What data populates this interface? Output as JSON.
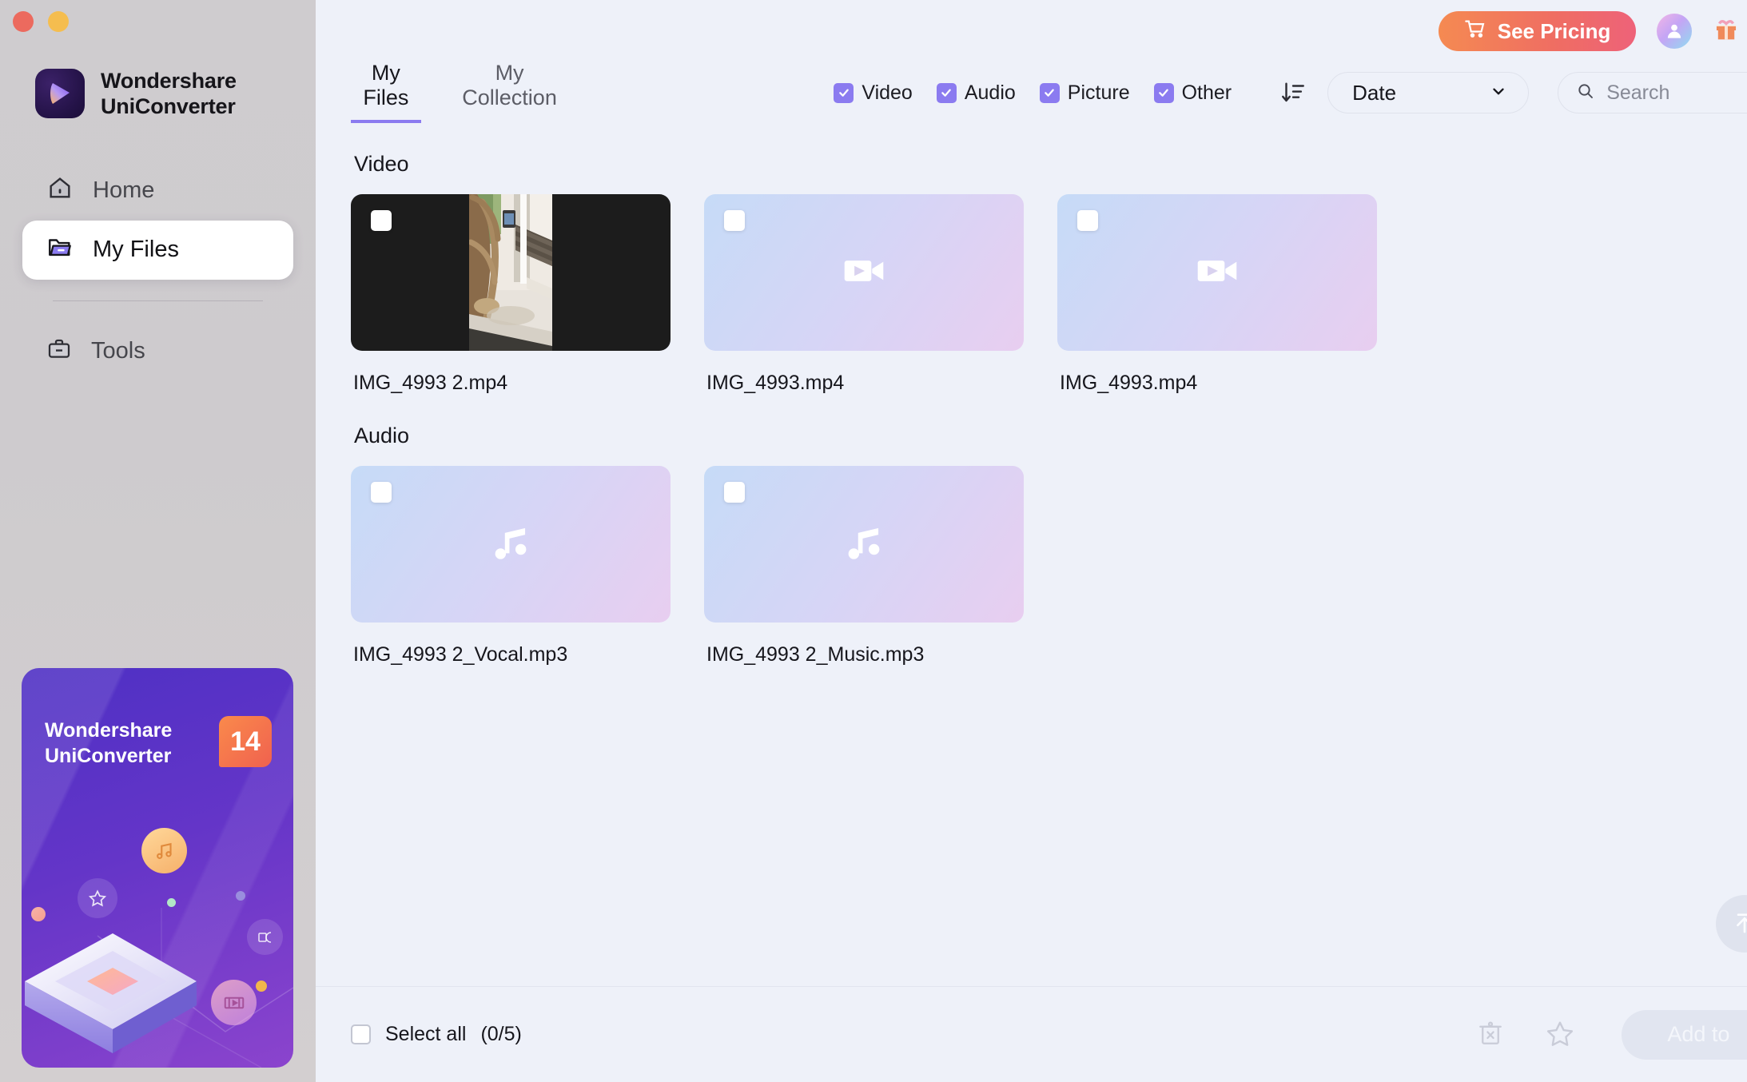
{
  "window": {
    "controls": [
      "close",
      "minimize"
    ]
  },
  "sidebar": {
    "brand": {
      "line1": "Wondershare",
      "line2": "UniConverter",
      "logo_icon": "play-logo-icon"
    },
    "items": [
      {
        "label": "Home",
        "icon": "home-icon",
        "active": false
      },
      {
        "label": "My Files",
        "icon": "folder-icon",
        "active": true
      },
      {
        "label": "Tools",
        "icon": "toolbox-icon",
        "active": false
      }
    ],
    "promo": {
      "title_line1": "Wondershare",
      "title_line2": "UniConverter",
      "version_badge": "14",
      "badge_color": "#f0614f",
      "background_color": "#6435c8"
    }
  },
  "topbar": {
    "pricing_label": "See Pricing",
    "pricing_icon": "cart-icon",
    "pricing_color": "#ef6d63",
    "avatar_icon": "user-avatar-icon",
    "gift_icon": "gift-icon",
    "support_icon": "headset-icon"
  },
  "toolbar": {
    "tabs": [
      {
        "label": "My Files",
        "active": true
      },
      {
        "label": "My Collection",
        "active": false
      }
    ],
    "accent_color": "#8b7bf0",
    "filters": [
      {
        "label": "Video",
        "checked": true
      },
      {
        "label": "Audio",
        "checked": true
      },
      {
        "label": "Picture",
        "checked": true
      },
      {
        "label": "Other",
        "checked": true
      }
    ],
    "sort_icon": "sort-descending-icon",
    "sort_value": "Date",
    "search": {
      "value": "",
      "placeholder": "Search",
      "icon": "search-icon"
    }
  },
  "content": {
    "sections": [
      {
        "title": "Video",
        "items": [
          {
            "name": "IMG_4993 2.mp4",
            "thumb": "photo",
            "selected": false
          },
          {
            "name": "IMG_4993.mp4",
            "thumb": "video-placeholder",
            "selected": false
          },
          {
            "name": "IMG_4993.mp4",
            "thumb": "video-placeholder",
            "selected": false
          }
        ]
      },
      {
        "title": "Audio",
        "items": [
          {
            "name": "IMG_4993 2_Vocal.mp3",
            "thumb": "audio-placeholder",
            "selected": false
          },
          {
            "name": "IMG_4993 2_Music.mp3",
            "thumb": "audio-placeholder",
            "selected": false
          }
        ]
      }
    ],
    "scroll_top_icon": "scroll-to-top-icon"
  },
  "bottombar": {
    "select_all_label": "Select all",
    "selection_count": "(0/5)",
    "select_all_checked": false,
    "delete_icon": "delete-icon",
    "favorite_icon": "star-icon",
    "add_to_label": "Add to",
    "add_to_enabled": false
  }
}
